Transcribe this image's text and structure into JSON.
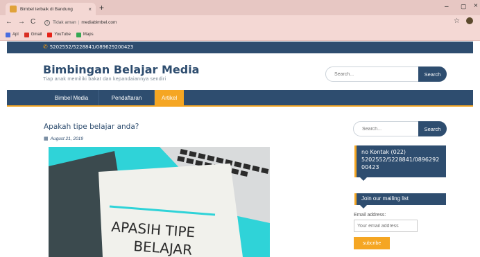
{
  "browser": {
    "tab_title": "Bimbel terbaik di Bandung",
    "tab_close": "×",
    "new_tab": "+",
    "url_security": "Tidak aman",
    "url": "mediabimbel.com",
    "min_symbol": "–",
    "max_symbol": "▢",
    "close_symbol": "×",
    "bookmarks": [
      {
        "label": "Apl",
        "color": "#4a6ee0"
      },
      {
        "label": "Gmail",
        "color": "#d93025"
      },
      {
        "label": "YouTube",
        "color": "#e62117"
      },
      {
        "label": "Maps",
        "color": "#34a853"
      }
    ]
  },
  "site": {
    "phone": "5202552/5228841/089629200423",
    "title": "Bimbingan Belajar Media",
    "subtitle": "Tiap anak memiliki bakat dan kepandaiannya sendiri",
    "search_placeholder": "Search...",
    "search_button": "Search",
    "nav": [
      {
        "label": "Bimbel Media",
        "active": false
      },
      {
        "label": "Pendaftaran",
        "active": false
      },
      {
        "label": "Artikel",
        "active": true
      }
    ],
    "colors": {
      "primary": "#2e4d6f",
      "accent": "#f5a623",
      "hero": "#2fd3d8"
    }
  },
  "post": {
    "title": "Apakah tipe belajar anda?",
    "date": "August 21, 2019",
    "image_text_line1": "APASIH TIPE",
    "image_text_line2": "BELAJAR"
  },
  "sidebar": {
    "search_placeholder": "Search...",
    "search_button": "Search",
    "contact_text": "no Kontak (022) 5202552/5228841/0896292 00423",
    "mailing_title": "Join our mailing list",
    "email_label": "Email address:",
    "email_placeholder": "Your email address",
    "subscribe": "subcribe"
  }
}
